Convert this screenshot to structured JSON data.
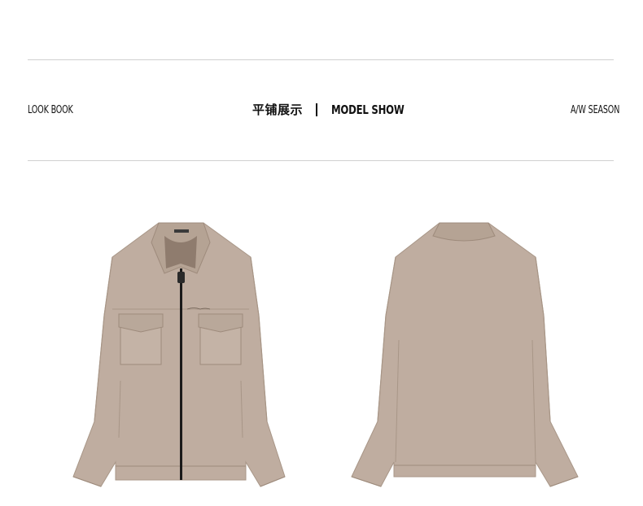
{
  "header": {
    "left_label": "LOOK BOOK",
    "center_cn": "平铺展示",
    "center_en": "MODEL SHOW",
    "right_label": "A/W SEASON"
  },
  "colors": {
    "jacket": "#bfada0",
    "jacket_shadow": "#a89687",
    "jacket_line": "#9e8b7c",
    "zipper": "#1a1a1a",
    "rule": "#d0d0d0"
  },
  "images": {
    "front": "jacket-front-flat-lay",
    "back": "jacket-back-flat-lay"
  }
}
